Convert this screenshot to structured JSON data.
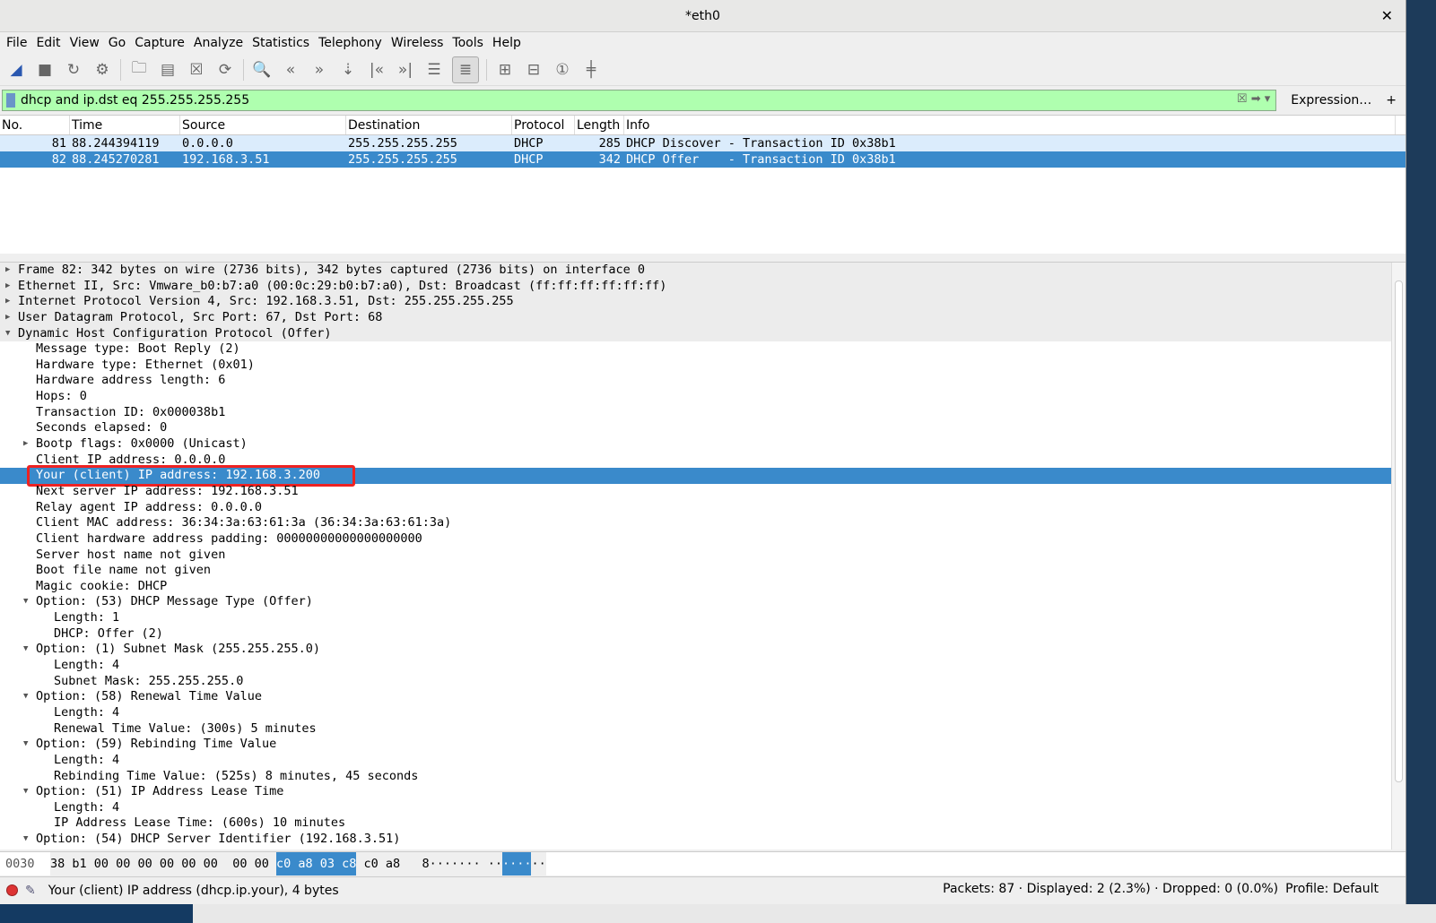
{
  "window": {
    "title": "*eth0"
  },
  "menu": [
    "File",
    "Edit",
    "View",
    "Go",
    "Capture",
    "Analyze",
    "Statistics",
    "Telephony",
    "Wireless",
    "Tools",
    "Help"
  ],
  "toolbar": [
    {
      "icon": "shark-fin-start-icon",
      "g": "◢"
    },
    {
      "icon": "stop-icon",
      "g": "■"
    },
    {
      "icon": "restart-icon",
      "g": "↻"
    },
    {
      "icon": "capture-options-icon",
      "g": "⚙"
    },
    {
      "sep": true
    },
    {
      "icon": "open-file-icon",
      "g": "🗀"
    },
    {
      "icon": "save-file-icon",
      "g": "▤"
    },
    {
      "icon": "close-file-icon",
      "g": "☒"
    },
    {
      "icon": "reload-icon",
      "g": "⟳"
    },
    {
      "sep": true
    },
    {
      "icon": "find-icon",
      "g": "🔍"
    },
    {
      "icon": "go-back-icon",
      "g": "«"
    },
    {
      "icon": "go-forward-icon",
      "g": "»"
    },
    {
      "icon": "go-to-packet-icon",
      "g": "⇣"
    },
    {
      "icon": "first-packet-icon",
      "g": "|«"
    },
    {
      "icon": "last-packet-icon",
      "g": "»|"
    },
    {
      "icon": "autoscroll-icon",
      "g": "☰"
    },
    {
      "icon": "colorize-icon",
      "g": "≣",
      "on": true
    },
    {
      "sep": true
    },
    {
      "icon": "zoom-in-icon",
      "g": "⊞"
    },
    {
      "icon": "zoom-out-icon",
      "g": "⊟"
    },
    {
      "icon": "normal-size-icon",
      "g": "①"
    },
    {
      "icon": "resize-columns-icon",
      "g": "╪"
    }
  ],
  "filter": {
    "value": "dhcp and ip.dst eq 255.255.255.255",
    "expression_label": "Expression…",
    "add_label": "+",
    "color": "#afffaf"
  },
  "packet_list": {
    "columns": [
      "No.",
      "Time",
      "Source",
      "Destination",
      "Protocol",
      "Length",
      "Info"
    ],
    "rows": [
      [
        "81",
        "88.244394119",
        "0.0.0.0",
        "255.255.255.255",
        "DHCP",
        "285",
        "DHCP Discover - Transaction ID 0x38b1"
      ],
      [
        "82",
        "88.245270281",
        "192.168.3.51",
        "255.255.255.255",
        "DHCP",
        "342",
        "DHCP Offer    - Transaction ID 0x38b1"
      ]
    ],
    "selected_index": 1
  },
  "details": [
    {
      "l": 0,
      "e": "c",
      "t": "Frame 82: 342 bytes on wire (2736 bits), 342 bytes captured (2736 bits) on interface 0"
    },
    {
      "l": 0,
      "e": "c",
      "t": "Ethernet II, Src: Vmware_b0:b7:a0 (00:0c:29:b0:b7:a0), Dst: Broadcast (ff:ff:ff:ff:ff:ff)"
    },
    {
      "l": 0,
      "e": "c",
      "t": "Internet Protocol Version 4, Src: 192.168.3.51, Dst: 255.255.255.255"
    },
    {
      "l": 0,
      "e": "c",
      "t": "User Datagram Protocol, Src Port: 67, Dst Port: 68"
    },
    {
      "l": 0,
      "e": "o",
      "t": "Dynamic Host Configuration Protocol (Offer)"
    },
    {
      "l": 1,
      "t": "Message type: Boot Reply (2)"
    },
    {
      "l": 1,
      "t": "Hardware type: Ethernet (0x01)"
    },
    {
      "l": 1,
      "t": "Hardware address length: 6"
    },
    {
      "l": 1,
      "t": "Hops: 0"
    },
    {
      "l": 1,
      "t": "Transaction ID: 0x000038b1"
    },
    {
      "l": 1,
      "t": "Seconds elapsed: 0"
    },
    {
      "l": 1,
      "e": "c",
      "t": "Bootp flags: 0x0000 (Unicast)"
    },
    {
      "l": 1,
      "t": "Client IP address: 0.0.0.0"
    },
    {
      "l": 1,
      "t": "Your (client) IP address: 192.168.3.200",
      "sel": true
    },
    {
      "l": 1,
      "t": "Next server IP address: 192.168.3.51"
    },
    {
      "l": 1,
      "t": "Relay agent IP address: 0.0.0.0"
    },
    {
      "l": 1,
      "t": "Client MAC address: 36:34:3a:63:61:3a (36:34:3a:63:61:3a)"
    },
    {
      "l": 1,
      "t": "Client hardware address padding: 00000000000000000000"
    },
    {
      "l": 1,
      "t": "Server host name not given"
    },
    {
      "l": 1,
      "t": "Boot file name not given"
    },
    {
      "l": 1,
      "t": "Magic cookie: DHCP"
    },
    {
      "l": 1,
      "e": "o",
      "t": "Option: (53) DHCP Message Type (Offer)"
    },
    {
      "l": 2,
      "t": "Length: 1"
    },
    {
      "l": 2,
      "t": "DHCP: Offer (2)"
    },
    {
      "l": 1,
      "e": "o",
      "t": "Option: (1) Subnet Mask (255.255.255.0)"
    },
    {
      "l": 2,
      "t": "Length: 4"
    },
    {
      "l": 2,
      "t": "Subnet Mask: 255.255.255.0"
    },
    {
      "l": 1,
      "e": "o",
      "t": "Option: (58) Renewal Time Value"
    },
    {
      "l": 2,
      "t": "Length: 4"
    },
    {
      "l": 2,
      "t": "Renewal Time Value: (300s) 5 minutes"
    },
    {
      "l": 1,
      "e": "o",
      "t": "Option: (59) Rebinding Time Value"
    },
    {
      "l": 2,
      "t": "Length: 4"
    },
    {
      "l": 2,
      "t": "Rebinding Time Value: (525s) 8 minutes, 45 seconds"
    },
    {
      "l": 1,
      "e": "o",
      "t": "Option: (51) IP Address Lease Time"
    },
    {
      "l": 2,
      "t": "Length: 4"
    },
    {
      "l": 2,
      "t": "IP Address Lease Time: (600s) 10 minutes"
    },
    {
      "l": 1,
      "e": "o",
      "t": "Option: (54) DHCP Server Identifier (192.168.3.51)"
    }
  ],
  "bytes": {
    "offset": "0030",
    "hex_pre": "38 b1 00 00 00 00 00 00  00 00 ",
    "hex_sel": "c0 a8 03 c8",
    "hex_post": " c0 a8",
    "ascii_pre": "8······· ··",
    "ascii_sel": "····",
    "ascii_post": "··"
  },
  "status": {
    "text": "Your (client) IP address (dhcp.ip.your), 4 bytes",
    "packets": "Packets: 87 · Displayed: 2 (2.3%) · Dropped: 0 (0.0%)",
    "profile": "Profile: Default"
  },
  "colors": {
    "selection": "#3a8acb",
    "alt_row": "#dbecfc",
    "highlight_box": "#ee2222"
  }
}
